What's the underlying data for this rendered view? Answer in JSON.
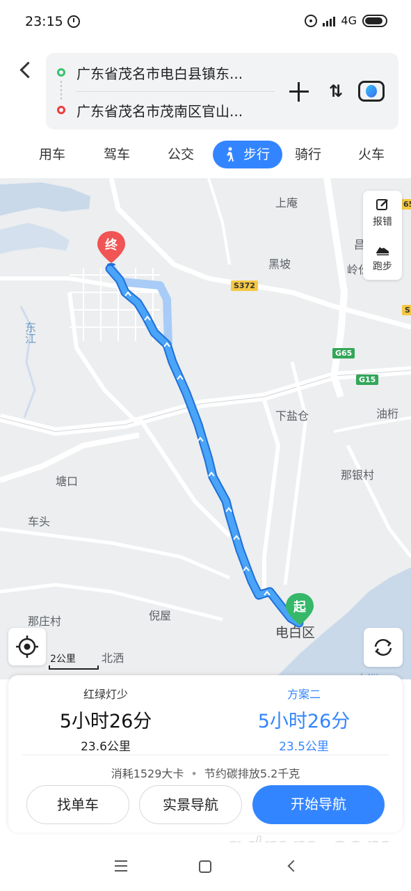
{
  "status_bar": {
    "time": "23:15",
    "network": "4G"
  },
  "route": {
    "start_address": "广东省茂名市电白县镇东...",
    "end_address": "广东省茂名市茂南区官山..."
  },
  "modes": {
    "tabs": [
      "用车",
      "驾车",
      "公交",
      "步行",
      "骑行",
      "火车"
    ],
    "active": "步行"
  },
  "map": {
    "places": {
      "shangan": "上庵",
      "heipo": "黑坡",
      "chang": "昌",
      "lingxia": "岭仫",
      "dongjiang": "东江",
      "xiayancang": "下盐仓",
      "youhang": "油桁",
      "tangkou": "塘口",
      "nayincun": "那银村",
      "chetou": "车头",
      "nazhuangcun": "那庄村",
      "niwu": "倪屋",
      "beiqi": "北洒",
      "dianbaiqu": "电白区",
      "dazhou": "大洲"
    },
    "road_badges": {
      "s372": "S372",
      "g65": "G65",
      "g15": "G15",
      "edge65": "65",
      "edgeS": "S"
    },
    "tools": {
      "report": "报错",
      "run": "跑步"
    },
    "markers": {
      "end": "终",
      "start": "起"
    },
    "scale": "2公里",
    "colors": {
      "route": "#3a8ef0",
      "route_alt": "#a8ccf7",
      "accent": "#3385ff"
    }
  },
  "plans": {
    "plan1": {
      "name": "红绿灯少",
      "duration": "5小时26分",
      "distance": "23.6公里"
    },
    "plan2": {
      "name": "方案二",
      "duration": "5小时26分",
      "distance": "23.5公里"
    }
  },
  "extra": {
    "calories": "消耗1529大卡",
    "carbon": "节约碳排放5.2千克"
  },
  "buttons": {
    "bike": "找单车",
    "ar_nav": "实景导航",
    "start_nav": "开始导航"
  },
  "watermark": "gdmm.com"
}
